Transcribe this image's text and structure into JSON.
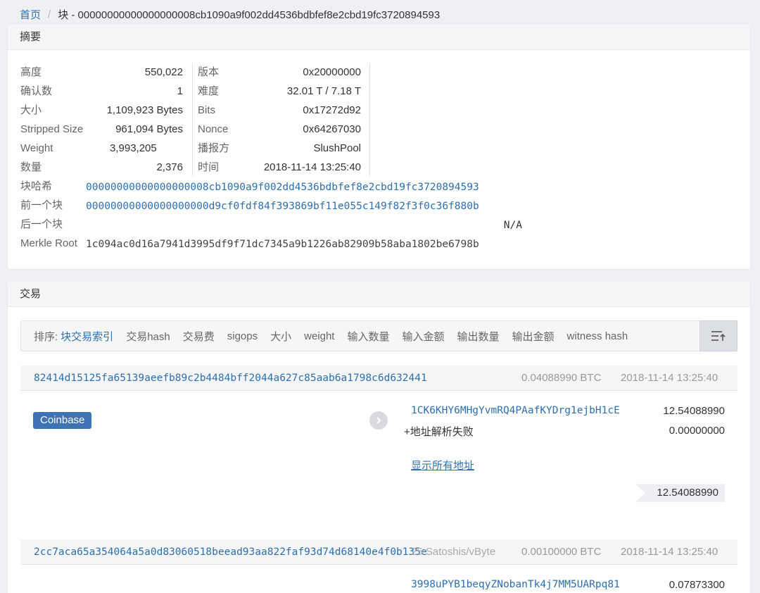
{
  "breadcrumb": {
    "home": "首页",
    "sep": "/",
    "current": "块 - 00000000000000000008cb1090a9f002dd4536bdbfef8e2cbd19fc3720894593"
  },
  "summary": {
    "title": "摘要",
    "left": [
      {
        "label": "高度",
        "value": "550,022"
      },
      {
        "label": "确认数",
        "value": "1"
      },
      {
        "label": "大小",
        "value": "1,109,923 Bytes"
      },
      {
        "label": "Stripped Size",
        "value": "961,094 Bytes"
      },
      {
        "label": "Weight",
        "value": "3,993,205"
      },
      {
        "label": "数量",
        "value": "2,376"
      }
    ],
    "right": [
      {
        "label": "版本",
        "value": "0x20000000"
      },
      {
        "label": "难度",
        "value": "32.01 T / 7.18 T"
      },
      {
        "label": "Bits",
        "value": "0x17272d92"
      },
      {
        "label": "Nonce",
        "value": "0x64267030"
      },
      {
        "label": "播报方",
        "value": "SlushPool"
      },
      {
        "label": "时间",
        "value": "2018-11-14 13:25:40"
      }
    ],
    "block_hash_label": "块哈希",
    "block_hash": "00000000000000000008cb1090a9f002dd4536bdbfef8e2cbd19fc3720894593",
    "prev_label": "前一个块",
    "prev_hash": "00000000000000000000d9cf0fdf84f393869bf11e055c149f82f3f0c36f880b",
    "next_label": "后一个块",
    "next_hash": "N/A",
    "merkle_label": "Merkle Root",
    "merkle": "1c094ac0d16a7941d3995df9f71dc7345a9b1226ab82909b58aba1802be6798b"
  },
  "transactions": {
    "title": "交易",
    "sort_label": "排序:",
    "sort_options": [
      "块交易索引",
      "交易hash",
      "交易费",
      "sigops",
      "大小",
      "weight",
      "输入数量",
      "输入金额",
      "输出数量",
      "输出金额",
      "witness hash"
    ],
    "tx1": {
      "hash": "82414d15125fa65139aeefb89c2b4484bff2044a627c85aab6a1798c6d632441",
      "amount": "0.04088990 BTC",
      "time": "2018-11-14 13:25:40",
      "input_badge": "Coinbase",
      "outputs": [
        {
          "address": "1CK6KHY6MHgYvmRQ4PAafKYDrg1ejbH1cE",
          "value": "12.54088990"
        },
        {
          "address": "+地址解析失败",
          "value": "0.00000000"
        }
      ],
      "show_all": "显示所有地址",
      "total": "12.54088990"
    },
    "tx2": {
      "hash": "2cc7aca65a354064a5a0d83060518beead93aa822faf93d74d68140e4f0b135e",
      "fee_rate": "25 Satoshis/vByte",
      "amount": "0.00100000 BTC",
      "time": "2018-11-14 13:25:40",
      "outputs": [
        {
          "address": "3998uPYB1beqyZNobanTk4j7MM5UARpq81",
          "value": "0.07873300"
        }
      ]
    }
  }
}
